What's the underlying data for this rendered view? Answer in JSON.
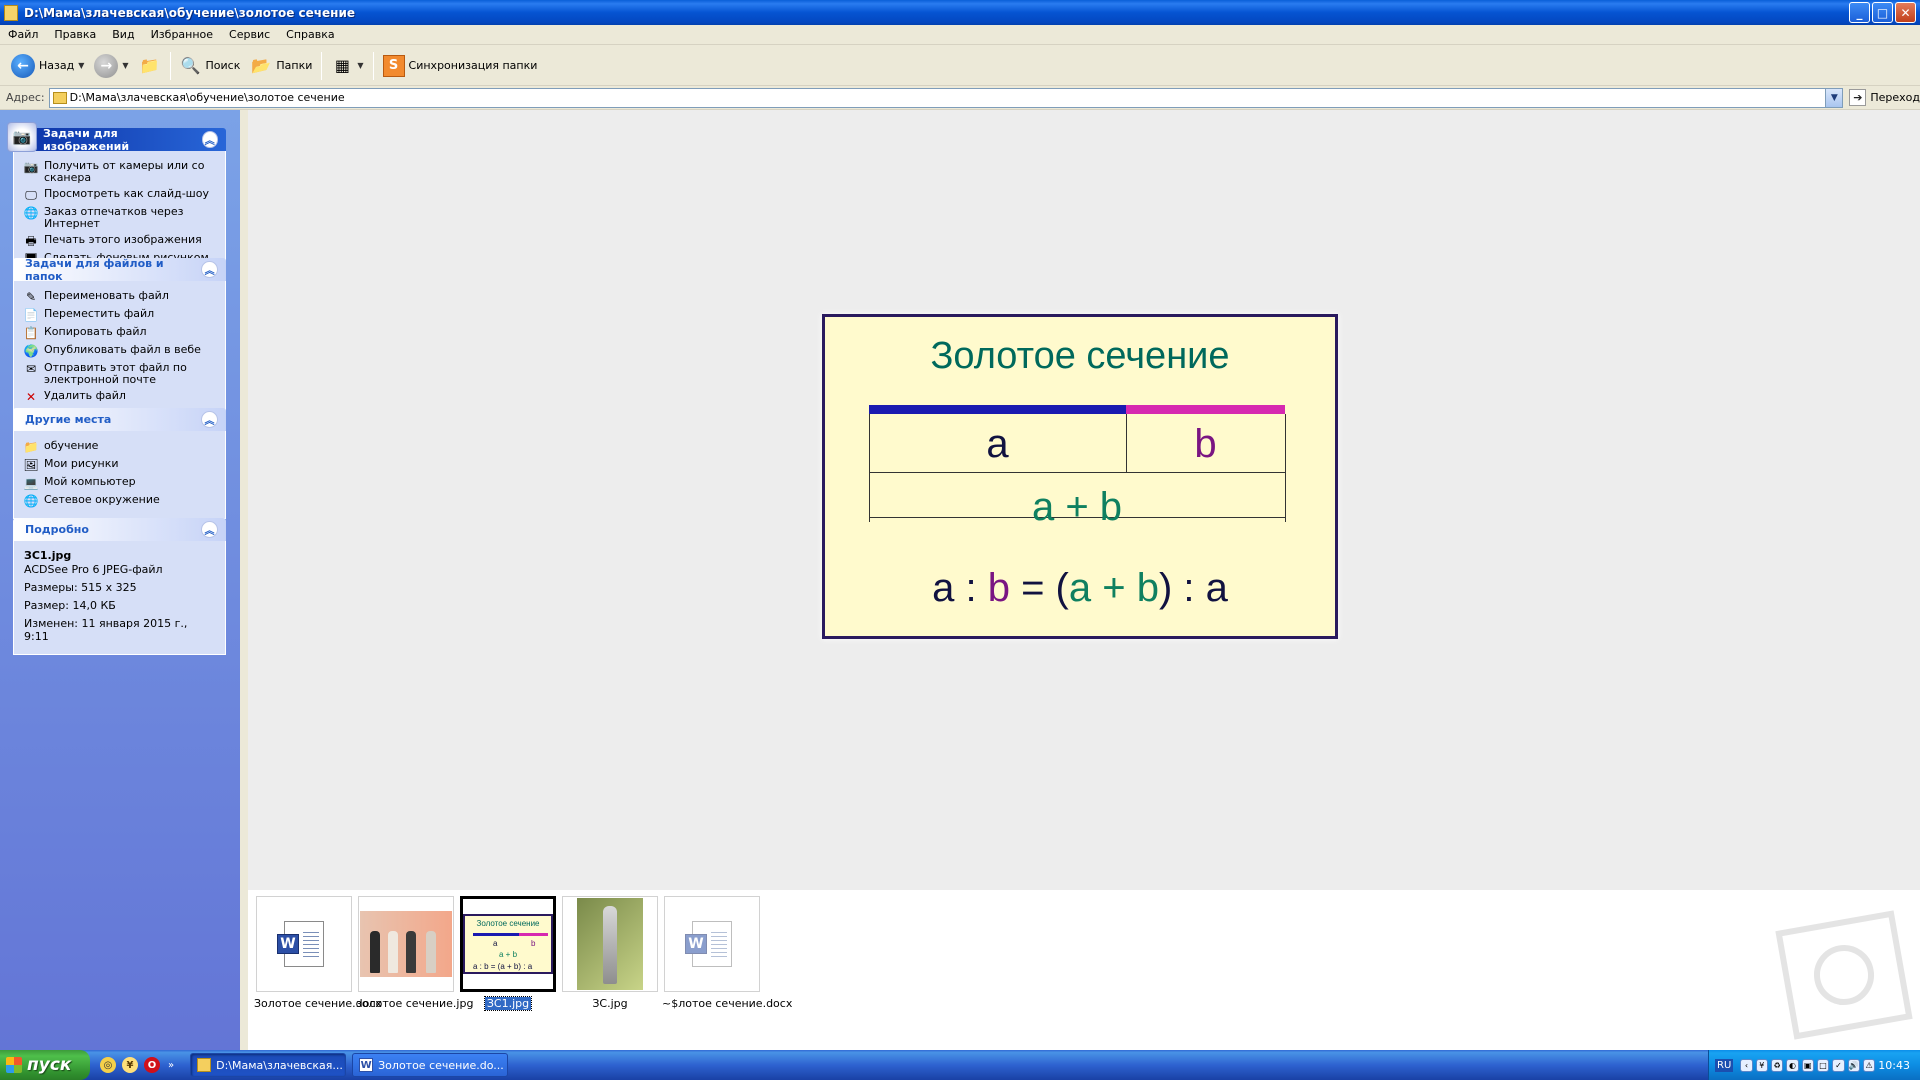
{
  "window": {
    "title": "D:\\Мама\\злачевская\\обучение\\золотое сечение",
    "buttons": [
      "_",
      "□",
      "✕"
    ]
  },
  "menu": [
    "Файл",
    "Правка",
    "Вид",
    "Избранное",
    "Сервис",
    "Справка"
  ],
  "toolbar": {
    "back_label": "Назад",
    "search_label": "Поиск",
    "folders_label": "Папки",
    "sync_label": "Синхронизация папки"
  },
  "address": {
    "label": "Адрес:",
    "value": "D:\\Мама\\злачевская\\обучение\\золотое сечение",
    "go_label": "Переход"
  },
  "taskpane": {
    "image_tasks": {
      "title": "Задачи для изображений",
      "items": [
        "Получить от камеры или со сканера",
        "Просмотреть как слайд-шоу",
        "Заказ отпечатков через Интернет",
        "Печать этого изображения",
        "Сделать фоновым рисунком рабочего стола"
      ]
    },
    "file_tasks": {
      "title": "Задачи для файлов и папок",
      "items": [
        "Переименовать файл",
        "Переместить файл",
        "Копировать файл",
        "Опубликовать файл в вебе",
        "Отправить этот файл по электронной почте",
        "Удалить файл"
      ]
    },
    "other_places": {
      "title": "Другие места",
      "items": [
        "обучение",
        "Мои рисунки",
        "Мой компьютер",
        "Сетевое окружение"
      ]
    },
    "details": {
      "title": "Подробно",
      "name": "ЗС1.jpg",
      "type": "ACDSee Pro 6 JPEG-файл",
      "dimensions": "Размеры: 515 x 325",
      "size": "Размер: 14,0 КБ",
      "modified": "Изменен: 11 января 2015 г., 9:11"
    }
  },
  "preview": {
    "title": "Золотое сечение",
    "label_a": "a",
    "label_b": "b",
    "label_sum": "a + b",
    "formula": {
      "a1": "a",
      "colon1": " : ",
      "b1": "b",
      "eq": " = (",
      "a2": "a",
      "plus": " + ",
      "b2": "b",
      "close": ") : ",
      "a3": "a"
    },
    "colors": {
      "a": "#111240",
      "b": "#7a1582",
      "sum": "#0f8060",
      "bar_a": "#1a1ab0",
      "bar_b": "#d628b0",
      "bg": "#fffacd"
    }
  },
  "filmstrip": [
    {
      "label": "Золотое сечение.docx",
      "kind": "word-doc"
    },
    {
      "label": "золотое сечение.jpg",
      "kind": "fashion-photo"
    },
    {
      "label": "ЗС1.jpg",
      "kind": "golden-ratio-image",
      "selected": true
    },
    {
      "label": "ЗС.jpg",
      "kind": "statue-photo"
    },
    {
      "label": "~$лотое сечение.docx",
      "kind": "word-doc-temp"
    }
  ],
  "mini_preview": {
    "title": "Золотое сечение",
    "a": "a",
    "b": "b",
    "sum": "a + b",
    "formula": "a : b = (a + b) : a"
  },
  "taskbar": {
    "start_label": "пуск",
    "tasks": [
      {
        "label": "D:\\Мама\\злачевская...",
        "active": true
      },
      {
        "label": "Золотое сечение.do...",
        "active": false
      }
    ],
    "lang": "RU",
    "clock": "10:43"
  }
}
